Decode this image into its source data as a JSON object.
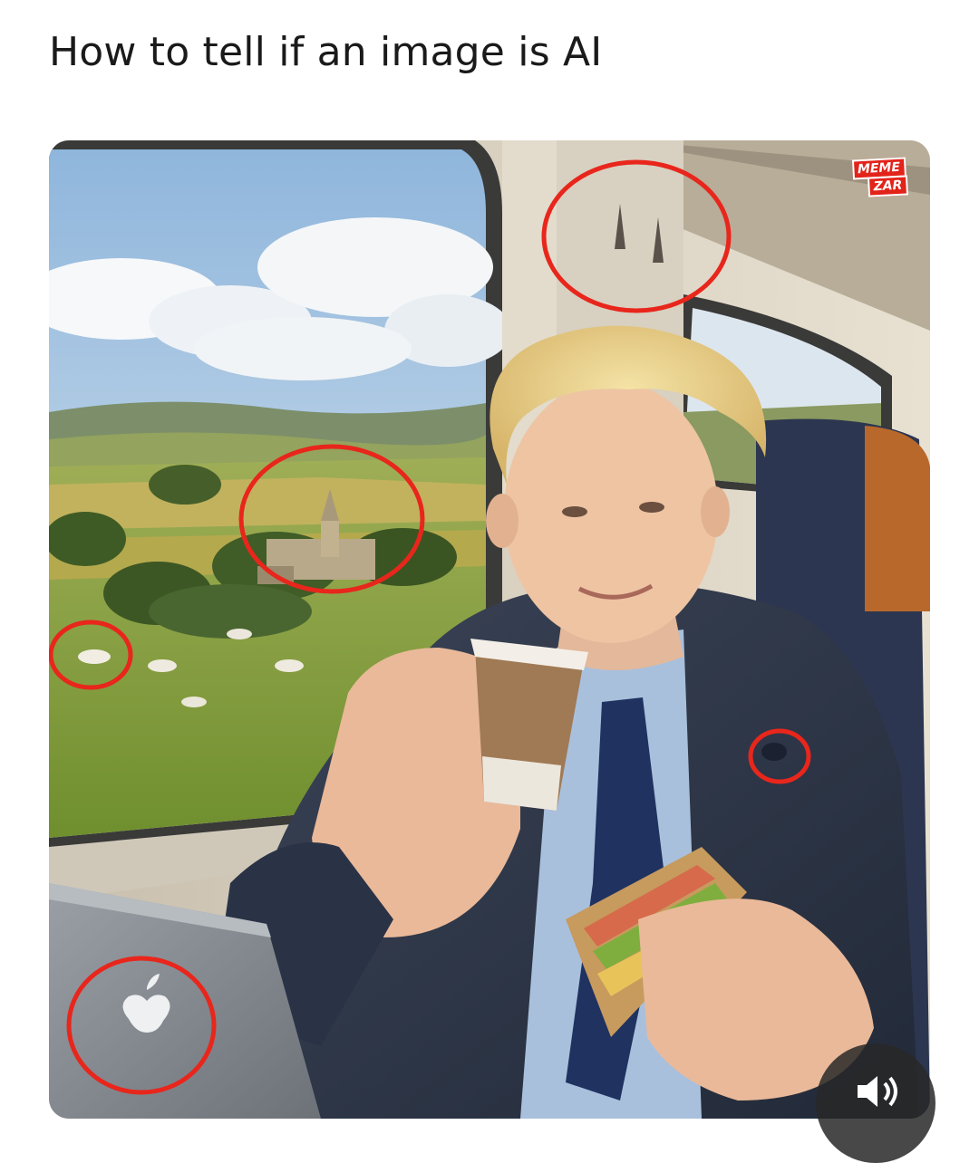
{
  "post": {
    "title": "How to tell if an image is AI"
  },
  "image": {
    "watermark": {
      "line1": "MEME",
      "line2": "ZAR"
    },
    "annotation_color": "#e8261c"
  },
  "controls": {
    "sound_icon": "speaker-muted-icon"
  }
}
